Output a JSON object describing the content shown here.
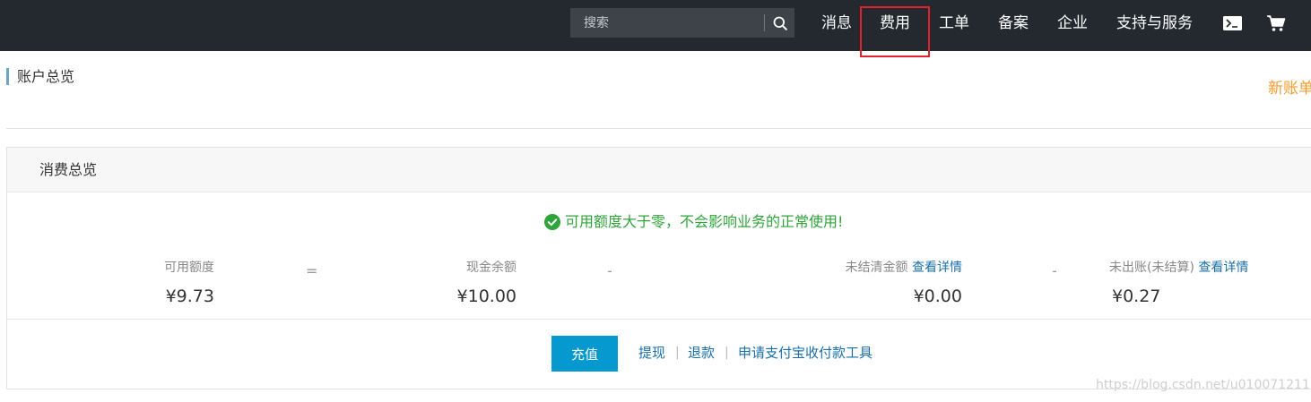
{
  "colors": {
    "topbar_bg": "#23292f",
    "accent_link": "#1a6fa8",
    "success": "#2fa43a",
    "recharge_button": "#0599cf",
    "new_account": "#f39c2c",
    "highlight_box": "#e3212e"
  },
  "topbar": {
    "search_placeholder": "搜索",
    "search_icon": "search-icon",
    "nav": {
      "messages": "消息",
      "billing": "费用",
      "tickets": "工单",
      "icp": "备案",
      "enterprise": "企业",
      "support": "支持与服务"
    },
    "terminal_icon": "terminal-icon",
    "cart_icon": "cart-icon"
  },
  "page": {
    "title": "账户总览",
    "new_account_text": "新账单"
  },
  "overview": {
    "title": "消费总览",
    "notice": "可用额度大于零，不会影响业务的正常使用!",
    "notice_icon": "check-circle-icon",
    "available": {
      "label": "可用额度",
      "value": "¥9.73"
    },
    "op_equals": "=",
    "cash": {
      "label": "现金余额",
      "value": "¥10.00"
    },
    "op_minus_1": "-",
    "unsettled": {
      "label": "未结清金额",
      "link": "查看详情",
      "value": "¥0.00"
    },
    "op_minus_2": "-",
    "unbilled": {
      "label": "未出账(未结算)",
      "link": "查看详情",
      "value": "¥0.27"
    }
  },
  "actions": {
    "recharge": "充值",
    "withdraw": "提现",
    "sep": "|",
    "refund": "退款",
    "alipay_tool": "申请支付宝收付款工具"
  },
  "watermark": "https://blog.csdn.net/u010071211"
}
